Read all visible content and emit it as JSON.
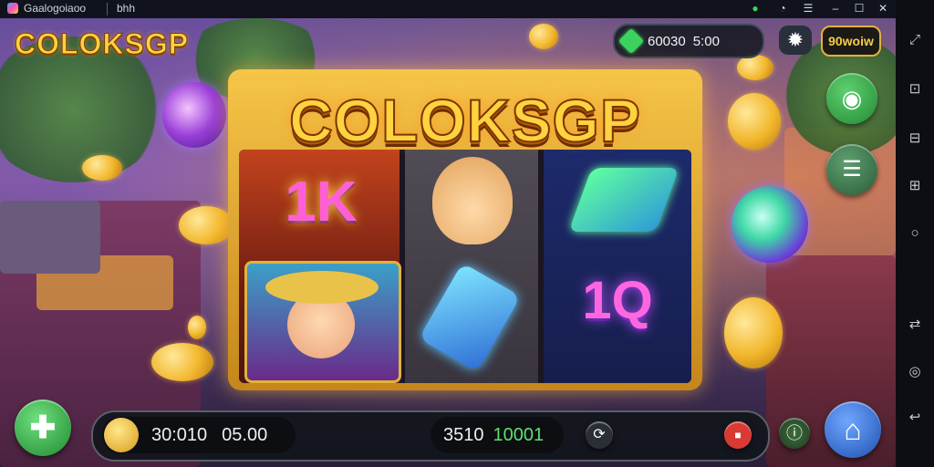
{
  "window": {
    "title": "Gaalogoiaoo",
    "subtitle": "bhh"
  },
  "game": {
    "logo": "COLOKSGP",
    "machine_title": "COLOKSGP",
    "gem_counter": {
      "value": "60030",
      "suffix": "5:00"
    },
    "mode_button": "90woiw",
    "balance": {
      "value": "30:010",
      "bet": "05.00"
    },
    "win": {
      "value": "3510",
      "suffix": "10001"
    },
    "reel_symbols": {
      "reel1_top": "1K",
      "reel3_bottom": "1Q"
    }
  },
  "icons": [
    "gem-icon",
    "gear-icon",
    "target-icon",
    "menu-icon",
    "plus-icon",
    "coin-icon",
    "home-icon",
    "info-icon",
    "spin-icon",
    "stop-icon"
  ],
  "colors": {
    "gold": "#ffd23f",
    "green_button": "#2f9a3f",
    "blue_button": "#2f6fd6",
    "red_button": "#d93a33"
  }
}
